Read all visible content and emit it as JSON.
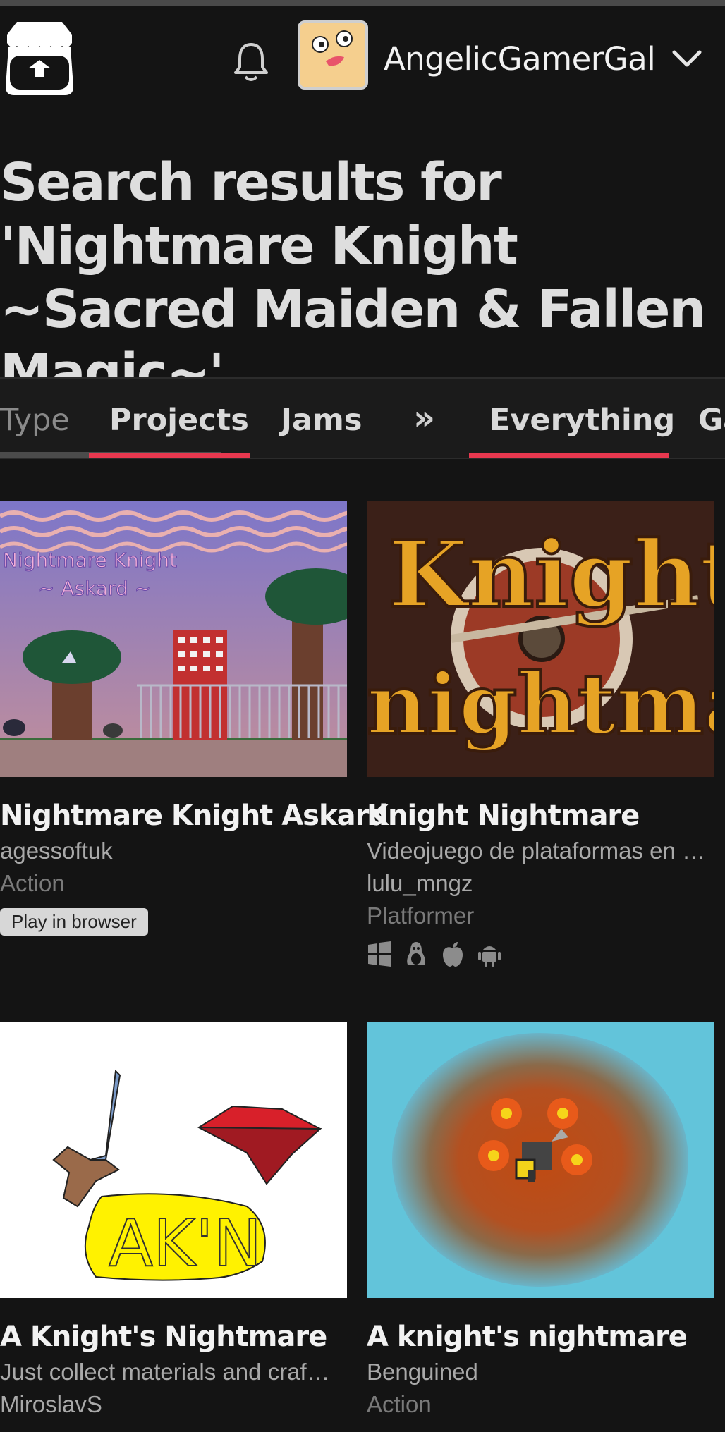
{
  "header": {
    "username": "AngelicGamerGal"
  },
  "search": {
    "title": "Search results for 'Nightmare Knight ~Sacred Maiden & Fallen Magic~'"
  },
  "tabs": {
    "type_label": "Type",
    "projects": "Projects",
    "jams": "Jams",
    "more": "»",
    "everything": "Everything",
    "games": "Ga"
  },
  "results": [
    {
      "title": "Nightmare Knight Askard",
      "author": "agessoftuk",
      "genre": "Action",
      "button": "Play in browser",
      "thumb_text": [
        "Nightmare Knight",
        "~ Askard ~"
      ]
    },
    {
      "title": "Knight Nightmare",
      "description": "Videojuego de plataformas en …",
      "author": "lulu_mngz",
      "genre": "Platformer",
      "platforms": [
        "windows-icon",
        "linux-icon",
        "apple-icon",
        "android-icon"
      ],
      "thumb_text": [
        "Knight",
        "nightmare"
      ]
    },
    {
      "title": "A Knight's Nightmare",
      "description": "Just collect materials and craf…",
      "author": "MiroslavS",
      "thumb_text": [
        "AK'N"
      ]
    },
    {
      "title": "A knight's nightmare",
      "author": "Benguined",
      "genre": "Action"
    }
  ],
  "colors": {
    "background": "#141414",
    "accent": "#e8384f"
  }
}
